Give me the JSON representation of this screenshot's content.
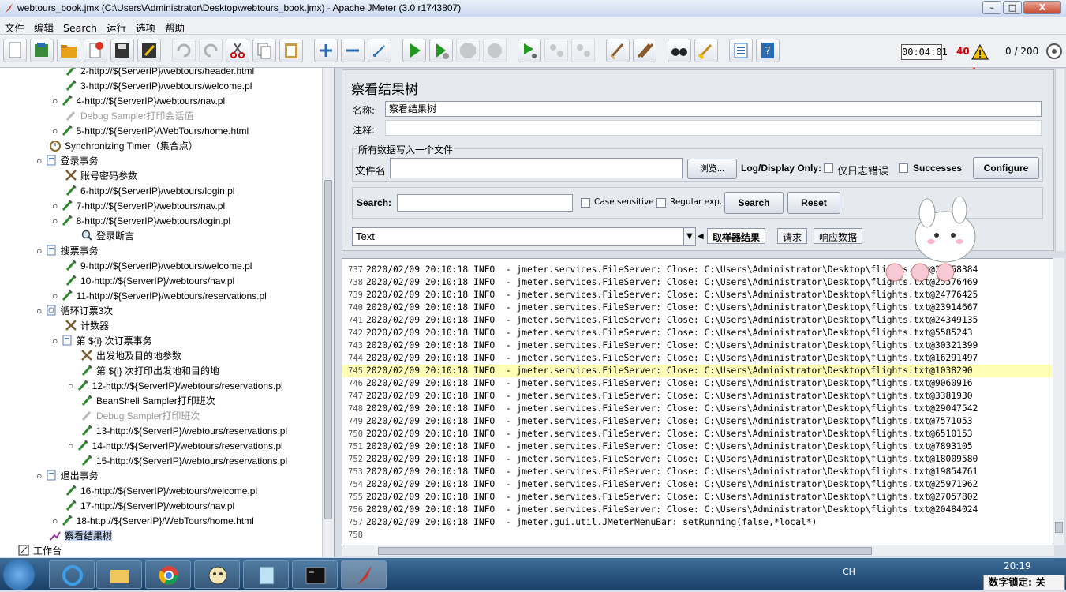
{
  "window": {
    "title": "webtours_book.jmx (C:\\Users\\Administrator\\Desktop\\webtours_book.jmx) - Apache JMeter (3.0 r1743807)",
    "minimize": "–",
    "maximize": "□",
    "close": "X"
  },
  "menu": [
    "文件",
    "编辑",
    "Search",
    "运行",
    "选项",
    "帮助"
  ],
  "status": {
    "elapsed": "00:04:01",
    "error_count": "40",
    "threads": "0 / 200"
  },
  "tree": [
    {
      "label": "2-http://${ServerIP}/webtours/header.html",
      "dim": false
    },
    {
      "label": "3-http://${ServerIP}/webtours/welcome.pl",
      "dim": false
    },
    {
      "label": "4-http://${ServerIP}/webtours/nav.pl",
      "dim": false
    },
    {
      "label": "Debug Sampler打印会话值",
      "dim": true
    },
    {
      "label": "5-http://${ServerIP}/WebTours/home.html",
      "dim": false
    },
    {
      "label": "Synchronizing Timer（集合点）",
      "dim": false
    },
    {
      "label": "登录事务",
      "dim": false
    },
    {
      "label": "账号密码参数",
      "dim": false
    },
    {
      "label": "6-http://${ServerIP}/webtours/login.pl",
      "dim": false
    },
    {
      "label": "7-http://${ServerIP}/webtours/nav.pl",
      "dim": false
    },
    {
      "label": "8-http://${ServerIP}/webtours/login.pl",
      "dim": false
    },
    {
      "label": "登录断言",
      "dim": false
    },
    {
      "label": "搜票事务",
      "dim": false
    },
    {
      "label": "9-http://${ServerIP}/webtours/welcome.pl",
      "dim": false
    },
    {
      "label": "10-http://${ServerIP}/webtours/nav.pl",
      "dim": false
    },
    {
      "label": "11-http://${ServerIP}/webtours/reservations.pl",
      "dim": false
    },
    {
      "label": "循环订票3次",
      "dim": false
    },
    {
      "label": "计数器",
      "dim": false
    },
    {
      "label": "第 ${i} 次订票事务",
      "dim": false
    },
    {
      "label": "出发地及目的地参数",
      "dim": false
    },
    {
      "label": "第 ${i} 次打印出发地和目的地",
      "dim": false
    },
    {
      "label": "12-http://${ServerIP}/webtours/reservations.pl",
      "dim": false
    },
    {
      "label": "BeanShell Sampler打印班次",
      "dim": false
    },
    {
      "label": "Debug Sampler打印班次",
      "dim": true
    },
    {
      "label": "13-http://${ServerIP}/webtours/reservations.pl",
      "dim": false
    },
    {
      "label": "14-http://${ServerIP}/webtours/reservations.pl",
      "dim": false
    },
    {
      "label": "15-http://${ServerIP}/webtours/reservations.pl",
      "dim": false
    },
    {
      "label": "退出事务",
      "dim": false
    },
    {
      "label": "16-http://${ServerIP}/webtours/welcome.pl",
      "dim": false
    },
    {
      "label": "17-http://${ServerIP}/webtours/nav.pl",
      "dim": false
    },
    {
      "label": "18-http://${ServerIP}/WebTours/home.html",
      "dim": false
    },
    {
      "label": "察看结果树",
      "dim": false
    },
    {
      "label": "工作台",
      "dim": false
    }
  ],
  "panel": {
    "title": "察看结果树",
    "name_label": "名称:",
    "name_value": "察看结果树",
    "comment_label": "注释:",
    "file_section": "所有数据写入一个文件",
    "filename_label": "文件名",
    "browse": "浏览...",
    "log_display": "Log/Display Only:",
    "errors_only": "仅日志错误",
    "successes": "Successes",
    "configure": "Configure",
    "search_label": "Search:",
    "case_sensitive": "Case sensitive",
    "regex": "Regular exp.",
    "search_btn": "Search",
    "reset_btn": "Reset",
    "renderer": "Text",
    "tabs": [
      "取样器结果",
      "请求",
      "响应数据"
    ]
  },
  "log": [
    {
      "n": "737",
      "text": "2020/02/09 20:10:18 INFO  - jmeter.services.FileServer: Close: C:\\Users\\Administrator\\Desktop\\flights.txt@28458384"
    },
    {
      "n": "738",
      "text": "2020/02/09 20:10:18 INFO  - jmeter.services.FileServer: Close: C:\\Users\\Administrator\\Desktop\\flights.txt@25576469"
    },
    {
      "n": "739",
      "text": "2020/02/09 20:10:18 INFO  - jmeter.services.FileServer: Close: C:\\Users\\Administrator\\Desktop\\flights.txt@24776425"
    },
    {
      "n": "740",
      "text": "2020/02/09 20:10:18 INFO  - jmeter.services.FileServer: Close: C:\\Users\\Administrator\\Desktop\\flights.txt@23914667"
    },
    {
      "n": "741",
      "text": "2020/02/09 20:10:18 INFO  - jmeter.services.FileServer: Close: C:\\Users\\Administrator\\Desktop\\flights.txt@24349135"
    },
    {
      "n": "742",
      "text": "2020/02/09 20:10:18 INFO  - jmeter.services.FileServer: Close: C:\\Users\\Administrator\\Desktop\\flights.txt@5585243"
    },
    {
      "n": "743",
      "text": "2020/02/09 20:10:18 INFO  - jmeter.services.FileServer: Close: C:\\Users\\Administrator\\Desktop\\flights.txt@30321399"
    },
    {
      "n": "744",
      "text": "2020/02/09 20:10:18 INFO  - jmeter.services.FileServer: Close: C:\\Users\\Administrator\\Desktop\\flights.txt@16291497"
    },
    {
      "n": "745",
      "text": "2020/02/09 20:10:18 INFO  - jmeter.services.FileServer: Close: C:\\Users\\Administrator\\Desktop\\flights.txt@1038290",
      "hl": true
    },
    {
      "n": "746",
      "text": "2020/02/09 20:10:18 INFO  - jmeter.services.FileServer: Close: C:\\Users\\Administrator\\Desktop\\flights.txt@9060916"
    },
    {
      "n": "747",
      "text": "2020/02/09 20:10:18 INFO  - jmeter.services.FileServer: Close: C:\\Users\\Administrator\\Desktop\\flights.txt@3381930"
    },
    {
      "n": "748",
      "text": "2020/02/09 20:10:18 INFO  - jmeter.services.FileServer: Close: C:\\Users\\Administrator\\Desktop\\flights.txt@29047542"
    },
    {
      "n": "749",
      "text": "2020/02/09 20:10:18 INFO  - jmeter.services.FileServer: Close: C:\\Users\\Administrator\\Desktop\\flights.txt@7571053"
    },
    {
      "n": "750",
      "text": "2020/02/09 20:10:18 INFO  - jmeter.services.FileServer: Close: C:\\Users\\Administrator\\Desktop\\flights.txt@6510153"
    },
    {
      "n": "751",
      "text": "2020/02/09 20:10:18 INFO  - jmeter.services.FileServer: Close: C:\\Users\\Administrator\\Desktop\\flights.txt@7893105"
    },
    {
      "n": "752",
      "text": "2020/02/09 20:10:18 INFO  - jmeter.services.FileServer: Close: C:\\Users\\Administrator\\Desktop\\flights.txt@18009580"
    },
    {
      "n": "753",
      "text": "2020/02/09 20:10:18 INFO  - jmeter.services.FileServer: Close: C:\\Users\\Administrator\\Desktop\\flights.txt@19854761"
    },
    {
      "n": "754",
      "text": "2020/02/09 20:10:18 INFO  - jmeter.services.FileServer: Close: C:\\Users\\Administrator\\Desktop\\flights.txt@25971962"
    },
    {
      "n": "755",
      "text": "2020/02/09 20:10:18 INFO  - jmeter.services.FileServer: Close: C:\\Users\\Administrator\\Desktop\\flights.txt@27057802"
    },
    {
      "n": "756",
      "text": "2020/02/09 20:10:18 INFO  - jmeter.services.FileServer: Close: C:\\Users\\Administrator\\Desktop\\flights.txt@20484024"
    },
    {
      "n": "757",
      "text": "2020/02/09 20:10:18 INFO  - jmeter.gui.util.JMeterMenuBar: setRunning(false,*local*)"
    },
    {
      "n": "758",
      "text": ""
    }
  ],
  "taskbar": {
    "ch": "CH",
    "clock": "20:19",
    "numlock": "数字锁定: 关"
  },
  "colors": {
    "error_red": "#d20000",
    "highlight": "#ffffb8",
    "selection": "#c5d5ee"
  }
}
